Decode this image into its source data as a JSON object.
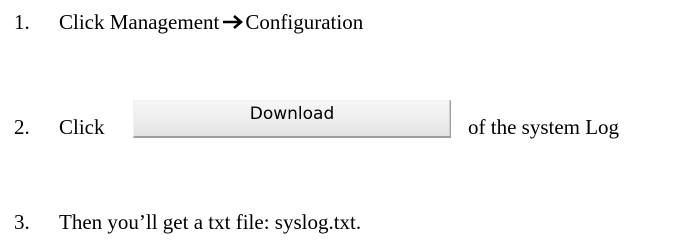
{
  "steps": [
    {
      "number": "1.",
      "prefix": "Click Management",
      "arrow_icon": "right-arrow-icon",
      "suffix": "Configuration"
    },
    {
      "number": "2.",
      "prefix": "Click",
      "button_label": "Download",
      "suffix": "of the system Log"
    },
    {
      "number": "3.",
      "text": "Then you’ll get a txt file: syslog.txt."
    }
  ]
}
